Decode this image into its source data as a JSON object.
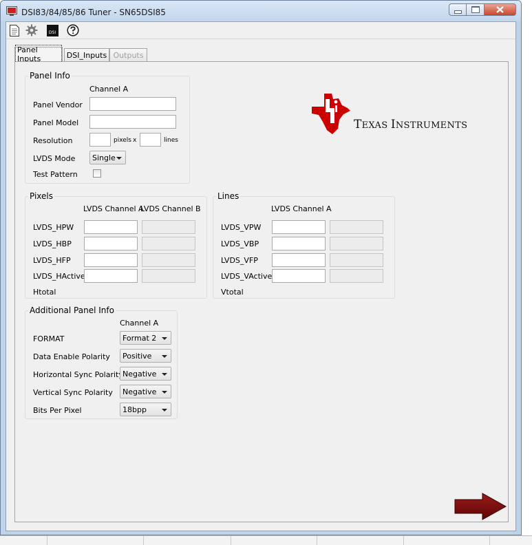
{
  "window": {
    "title": "DSI83/84/85/86 Tuner - SN65DSI85",
    "minimize_icon": "minimize-icon",
    "maximize_icon": "maximize-icon",
    "close_icon": "close-icon"
  },
  "toolbar": {
    "icons": [
      "document-icon",
      "gear-icon",
      "dsi-icon",
      "help-icon"
    ],
    "dsi_badge": "DSI"
  },
  "tabs": [
    {
      "label": "Panel Inputs",
      "state": "active"
    },
    {
      "label": "DSI_Inputs",
      "state": "normal"
    },
    {
      "label": "Outputs",
      "state": "disabled"
    }
  ],
  "logo": {
    "brand": "TEXAS INSTRUMENTS",
    "first_cap": "T",
    "rest1": "EXAS ",
    "cap2": "I",
    "rest2": "NSTRUMENTS",
    "color": "#cc0000"
  },
  "panel_info": {
    "title": "Panel Info",
    "channel_header": "Channel A",
    "vendor_label": "Panel Vendor",
    "vendor_value": "",
    "model_label": "Panel Model",
    "model_value": "",
    "resolution_label": "Resolution",
    "pixels_unit": "pixels",
    "x_sep": "x",
    "lines_unit": "lines",
    "lvds_mode_label": "LVDS Mode",
    "lvds_mode_value": "Single",
    "test_pattern_label": "Test Pattern",
    "test_pattern_checked": false
  },
  "pixels": {
    "title": "Pixels",
    "col_a": "LVDS Channel A",
    "col_b": "LVDS Channel B",
    "rows": [
      {
        "label": "LVDS_HPW",
        "a": "",
        "b": ""
      },
      {
        "label": "LVDS_HBP",
        "a": "",
        "b": ""
      },
      {
        "label": "LVDS_HFP",
        "a": "",
        "b": ""
      },
      {
        "label": "LVDS_HActive",
        "a": "",
        "b": ""
      }
    ],
    "total_label": "Htotal"
  },
  "lines": {
    "title": "Lines",
    "col_a": "LVDS Channel A",
    "rows": [
      {
        "label": "LVDS_VPW",
        "a": "",
        "b": ""
      },
      {
        "label": "LVDS_VBP",
        "a": "",
        "b": ""
      },
      {
        "label": "LVDS_VFP",
        "a": "",
        "b": ""
      },
      {
        "label": "LVDS_VActive",
        "a": "",
        "b": ""
      }
    ],
    "total_label": "Vtotal"
  },
  "additional": {
    "title": "Additional Panel Info",
    "channel_header": "Channel A",
    "rows": [
      {
        "label": "FORMAT",
        "value": "Format 2"
      },
      {
        "label": "Data Enable Polarity",
        "value": "Positive"
      },
      {
        "label": "Horizontal Sync Polarity",
        "value": "Negative"
      },
      {
        "label": "Vertical Sync Polarity",
        "value": "Negative"
      },
      {
        "label": "Bits Per Pixel",
        "value": "18bpp"
      }
    ]
  },
  "next_button": {
    "icon": "next-arrow-icon",
    "color": "#7a0c0c"
  }
}
